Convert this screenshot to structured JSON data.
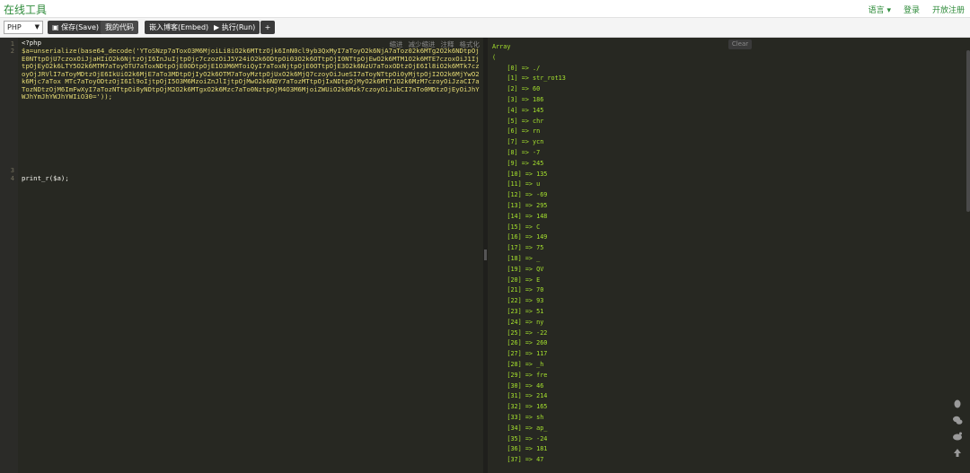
{
  "header": {
    "brand": "在线工具",
    "nav": [
      "语言 ▾",
      "登录",
      "开放注册"
    ]
  },
  "toolbar": {
    "language": "PHP",
    "save_label": "保存(Save)",
    "my_code_label": "我的代码",
    "embed_label": "嵌入博客(Embed)",
    "run_label": "执行(Run)",
    "add_label": "+"
  },
  "editor": {
    "actions": [
      "缩进",
      "减少缩进",
      "注释",
      "格式化"
    ],
    "line_numbers": [
      "1",
      "2",
      "3",
      "4"
    ],
    "line1": "<?php",
    "line2": "$a=unserialize(base64_decode('YToSNzp7aToxO3M6MjoiLi8iO2k6MTtzOjk6InN0cl9yb3QxMyI7aToyO2k6NjA7aToz02k6MTg2O2k6NDtpOjE0NTtpOjU7czoxOiJjaHIiO2k6NjtzOjI6InJuIjtpOjc7czozOiJ5Y24iO2k6ODtpOi03O2k6OTtpOjI0NTtpOjEwO2k6MTM1O2k6MTE7czoxOiJ1IjtpOjEyO2k6LTY5O2k6MTM7aToyOTU7aToxNDtpOjE0ODtpOjE1O3M6MToiQyI7aToxNjtpOjE0OTtpOjE3O2k6NzU7aToxODtzOjE6Il8iO2k6MTk7czoyOjJRVlI7aToyMDtzOjE6IkUiO2k6MjE7aTo3MDtpOjIyO2k6OTM7aToyMztpOjUxO2k6MjQ7czoyOiJueSI7aToyNTtpOi0yMjtpOjI2O2k6MjYwO2k6Mjc7aTox MTc7aToyODtzOjI6Il9oIjtpOjI5O3M6MzoiZnJlIjtpOjMwO2k6NDY7aTozMTtpOjIxNDtpOjMyO2k6MTY1O2k6MzM7czoyOiJzaCI7aTozNDtzOjM6ImFwXyI7aTozNTtpOi0yNDtpOjM2O2k6MTgxO2k6Mzc7aTo0NztpOjM4O3M6MjoiZWUiO2k6Mzk7czoyOiJubCI7aTo0MDtzOjEyOiJhYWJhYmJhYWJhYWIiO30='));",
    "line4": "print_r($a);"
  },
  "output": {
    "clear_label": "Clear",
    "lines": [
      "Array",
      "(",
      "    [0] => ./",
      "    [1] => str_rot13",
      "    [2] => 60",
      "    [3] => 186",
      "    [4] => 145",
      "    [5] => chr",
      "    [6] => rn",
      "    [7] => ycn",
      "    [8] => -7",
      "    [9] => 245",
      "    [10] => 135",
      "    [11] => u",
      "    [12] => -69",
      "    [13] => 295",
      "    [14] => 148",
      "    [15] => C",
      "    [16] => 149",
      "    [17] => 75",
      "    [18] => _",
      "    [19] => QV",
      "    [20] => E",
      "    [21] => 70",
      "    [22] => 93",
      "    [23] => 51",
      "    [24] => ny",
      "    [25] => -22",
      "    [26] => 260",
      "    [27] => 117",
      "    [28] => _h",
      "    [29] => fre",
      "    [30] => 46",
      "    [31] => 214",
      "    [32] => 165",
      "    [33] => sh",
      "    [34] => ap_",
      "    [35] => -24",
      "    [36] => 181",
      "    [37] => 47"
    ]
  },
  "side_icons": [
    "qq-icon",
    "wechat-icon",
    "weibo-icon",
    "back-to-top-icon"
  ]
}
